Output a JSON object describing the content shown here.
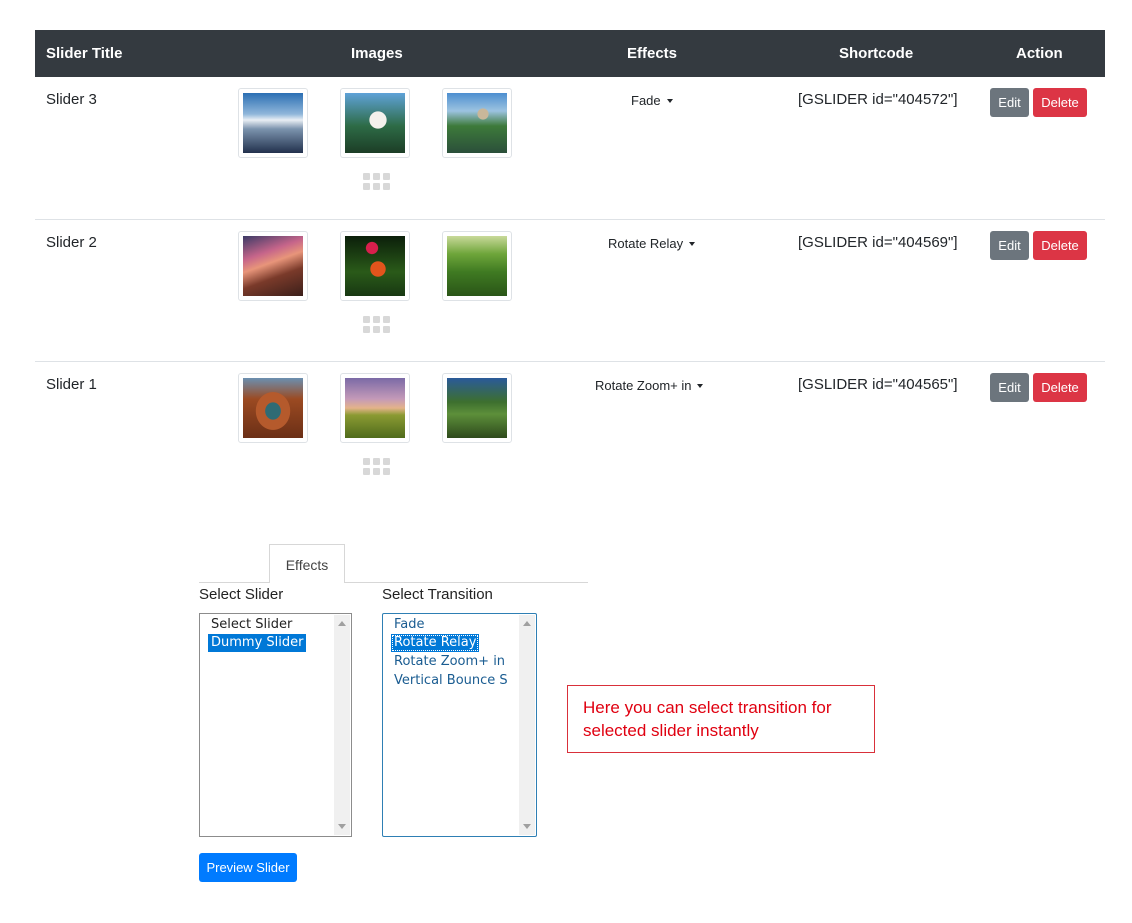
{
  "table": {
    "headers": {
      "title": "Slider Title",
      "images": "Images",
      "effects": "Effects",
      "shortcode": "Shortcode",
      "action": "Action"
    },
    "rows": [
      {
        "title": "Slider 3",
        "images": [
          "snowy-mountain-lake-landscape",
          "castle-on-green-hill",
          "church-by-river-landscape"
        ],
        "effect": "Fade",
        "shortcode": "[GSLIDER id=\"404572\"]",
        "edit_label": "Edit",
        "delete_label": "Delete"
      },
      {
        "title": "Slider 2",
        "images": [
          "sunset-mountain-peaks",
          "butterfly-on-flower",
          "green-terraced-hills"
        ],
        "effect": "Rotate Relay",
        "shortcode": "[GSLIDER id=\"404569\"]",
        "edit_label": "Edit",
        "delete_label": "Delete"
      },
      {
        "title": "Slider 1",
        "images": [
          "canyon-river-bend",
          "purple-sky-field",
          "tree-lined-path-at-sunset"
        ],
        "effect": "Rotate Zoom+ in",
        "shortcode": "[GSLIDER id=\"404565\"]",
        "edit_label": "Edit",
        "delete_label": "Delete"
      }
    ]
  },
  "effects_panel": {
    "tab_label": "Effects",
    "select_slider_label": "Select Slider",
    "select_slider_options": [
      "Select Slider",
      "Dummy Slider"
    ],
    "select_slider_selected": "Dummy Slider",
    "select_transition_label": "Select Transition",
    "transition_options": [
      "Fade",
      "Rotate Relay",
      "Rotate Zoom+ in",
      "Vertical Bounce Strip"
    ],
    "transition_selected": "Rotate Relay",
    "preview_button": "Preview Slider"
  },
  "callout": {
    "text": "Here you can select transition for selected slider instantly",
    "color": "#e00010"
  },
  "colors": {
    "table_header_bg": "#343a40",
    "edit_button": "#6c757d",
    "delete_button": "#dc3545",
    "primary_button": "#007bff",
    "listbox_selection": "#0078d7"
  }
}
